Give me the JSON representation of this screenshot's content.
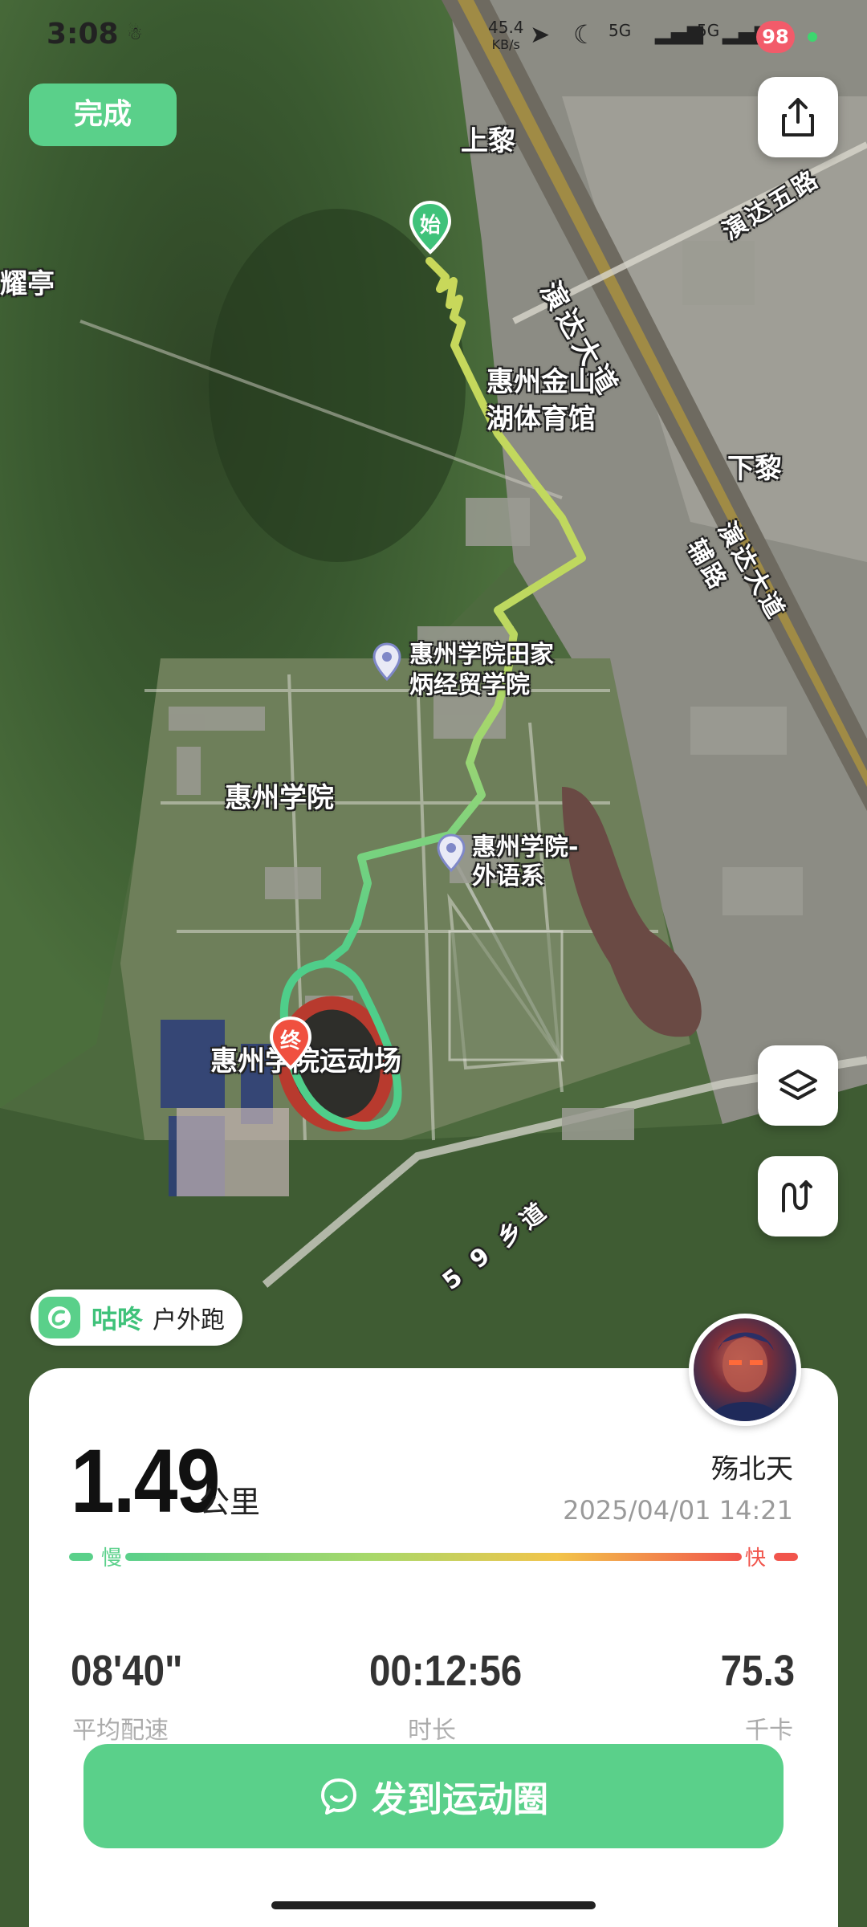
{
  "status_bar": {
    "time": "3:08",
    "net_speed_value": "45.4",
    "net_speed_unit": "KB/s",
    "signal1": "5G",
    "signal2": "5G",
    "battery": "98"
  },
  "toolbar": {
    "done_label": "完成"
  },
  "map": {
    "labels": {
      "shangli": "上黎",
      "xiali": "下黎",
      "yaoting": "耀亭",
      "yanda_road": "演达大道",
      "yanda_5th": "演达五路",
      "yanda_aux": "演达大道辅路",
      "stadium_line1": "惠州金山",
      "stadium_line2": "湖体育馆",
      "college_business_line1": "惠州学院田家",
      "college_business_line2": "炳经贸学院",
      "university": "惠州学院",
      "foreign_lang_line1": "惠州学院-",
      "foreign_lang_line2": "外语系",
      "sports_field": "惠州学院运动场",
      "road59": "5 9 乡道"
    },
    "start_marker": "始",
    "end_marker": "终"
  },
  "app_chip": {
    "brand": "咕咚",
    "sport": "户外跑"
  },
  "summary": {
    "distance": "1.49",
    "distance_unit": "公里",
    "username": "殇北天",
    "datetime": "2025/04/01 14:21",
    "pace_slow": "慢",
    "pace_fast": "快",
    "stats": [
      {
        "value": "08'40\"",
        "label": "平均配速"
      },
      {
        "value": "00:12:56",
        "label": "时长"
      },
      {
        "value": "75.3",
        "label": "千卡"
      }
    ]
  },
  "share_button_label": "发到运动圈",
  "colors": {
    "accent_green": "#5ad08a",
    "route_early": "#c7d95b",
    "route_late": "#4fce8a",
    "end_marker": "#f0503f"
  }
}
